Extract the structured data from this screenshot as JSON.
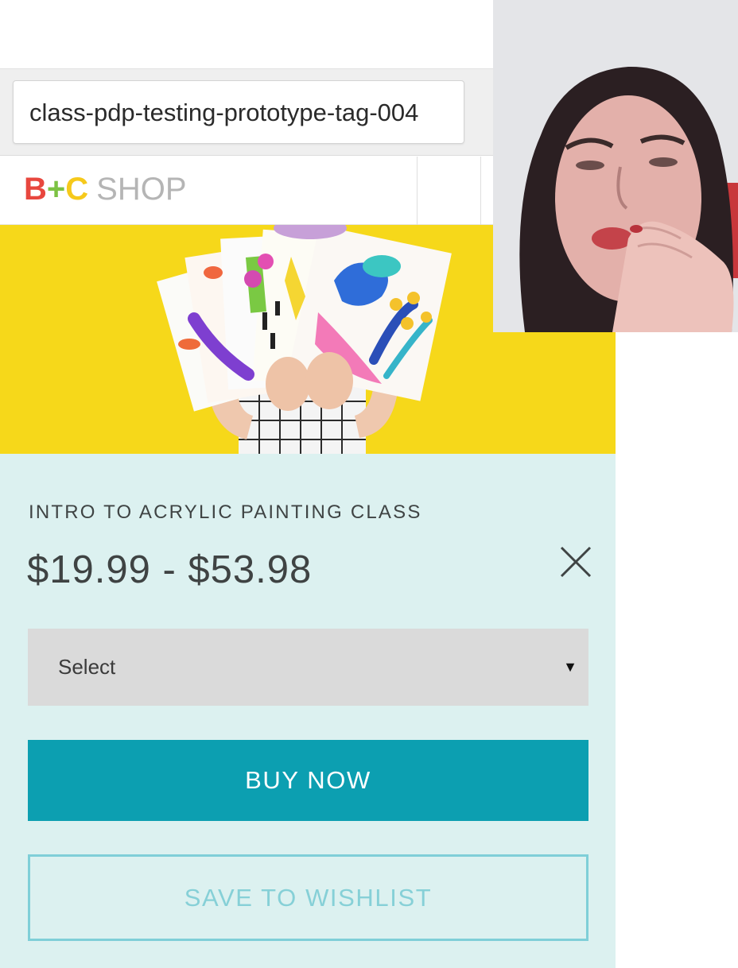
{
  "browser": {
    "url": "class-pdp-testing-prototype-tag-004"
  },
  "header": {
    "logo": {
      "b": "B",
      "plus": "+",
      "c": "C",
      "shop": "SHOP"
    }
  },
  "hero": {
    "icon": "hero-artwork-image"
  },
  "webcam": {
    "icon": "webcam-video-feed"
  },
  "product": {
    "title": "INTRO TO ACRYLIC PAINTING CLASS",
    "price": "$19.99 - $53.98",
    "select_label": "Select",
    "select_arrow": "▼",
    "buy_label": "BUY NOW",
    "wishlist_label": "SAVE TO WISHLIST"
  },
  "colors": {
    "hero_yellow": "#f6d81a",
    "panel_bg": "#dcf1f0",
    "buy_button": "#0c9fb1",
    "wishlist_border": "#7fcfd8",
    "logo_b": "#e8473e",
    "logo_plus": "#7cc243",
    "logo_c": "#f6c91b"
  }
}
